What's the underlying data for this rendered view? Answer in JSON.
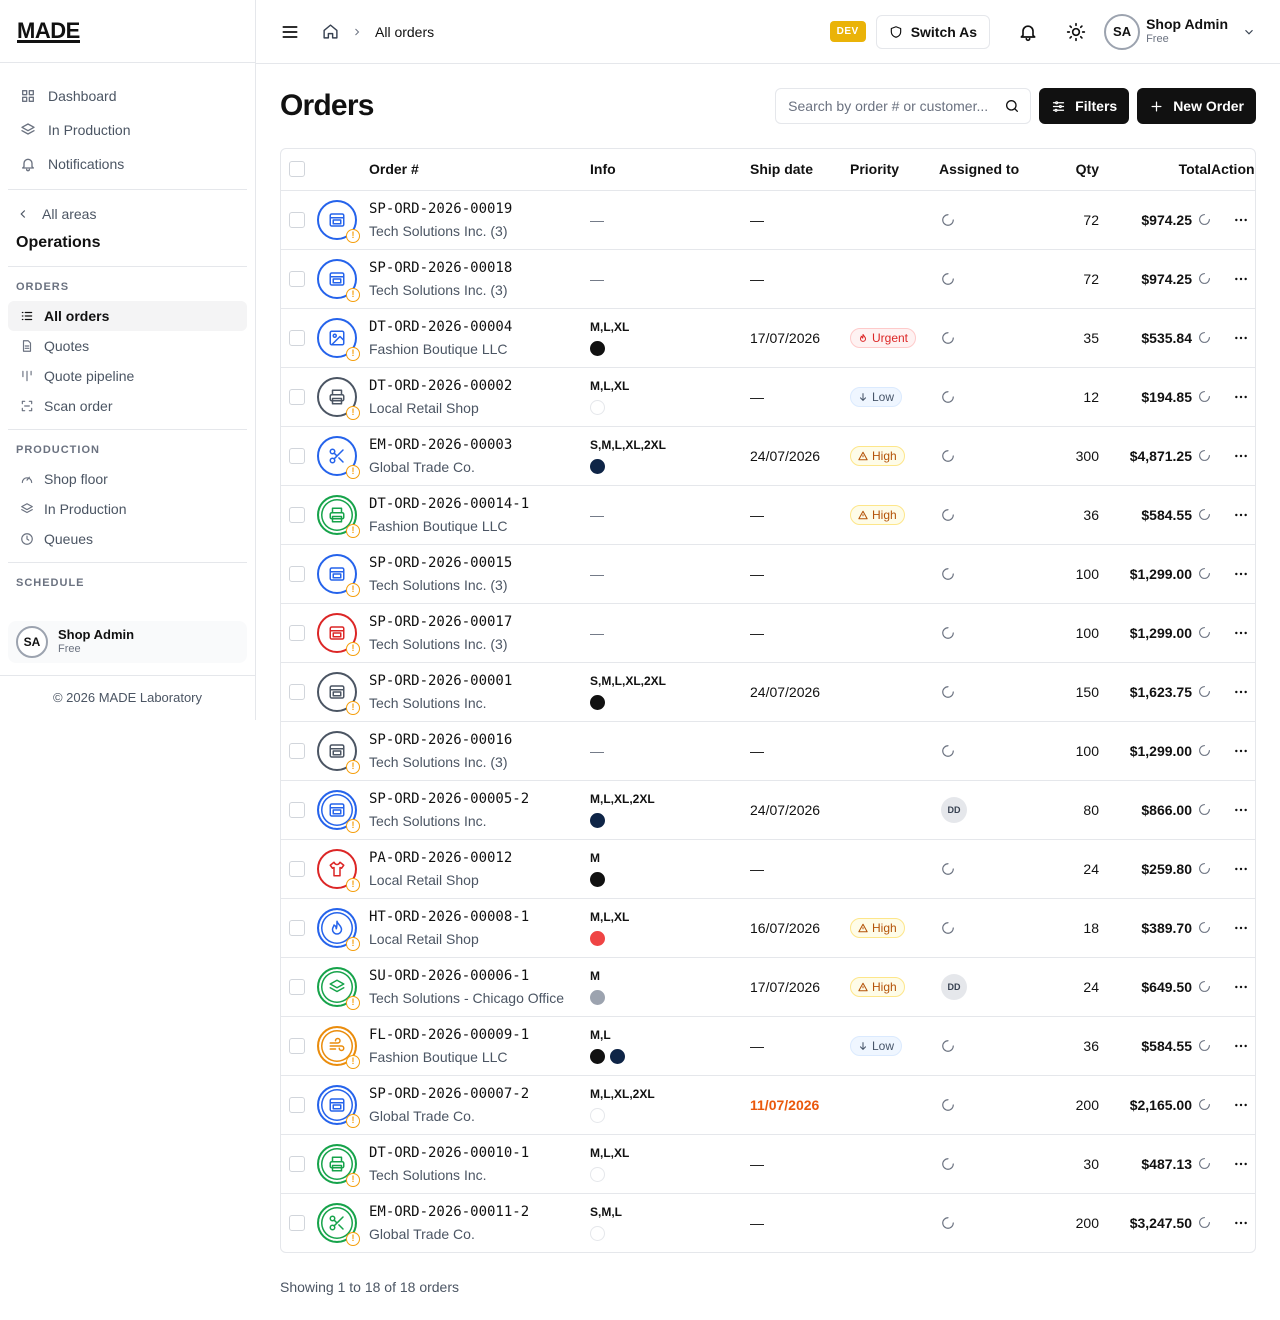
{
  "brand": "MADE",
  "sidebar": {
    "top_items": [
      {
        "label": "Dashboard",
        "icon": "grid-icon"
      },
      {
        "label": "In Production",
        "icon": "layers-icon"
      },
      {
        "label": "Notifications",
        "icon": "bell-icon"
      }
    ],
    "back_label": "All areas",
    "area_title": "Operations",
    "groups": [
      {
        "label": "ORDERS",
        "items": [
          {
            "label": "All orders",
            "icon": "list-icon",
            "active": true
          },
          {
            "label": "Quotes",
            "icon": "file-icon"
          },
          {
            "label": "Quote pipeline",
            "icon": "pipeline-icon"
          },
          {
            "label": "Scan order",
            "icon": "scan-icon"
          }
        ]
      },
      {
        "label": "PRODUCTION",
        "items": [
          {
            "label": "Shop floor",
            "icon": "gauge-icon"
          },
          {
            "label": "In Production",
            "icon": "layers-icon"
          },
          {
            "label": "Queues",
            "icon": "clock-icon"
          }
        ]
      },
      {
        "label": "SCHEDULE",
        "items": []
      }
    ],
    "user": {
      "initials": "SA",
      "name": "Shop Admin",
      "plan": "Free"
    },
    "copyright": "© 2026 MADE Laboratory"
  },
  "header": {
    "breadcrumb": "All orders",
    "env_badge": "DEV",
    "switch_label": "Switch As",
    "user": {
      "initials": "SA",
      "name": "Shop Admin",
      "plan": "Free"
    }
  },
  "main": {
    "title": "Orders",
    "search_placeholder": "Search by order # or customer...",
    "filters_label": "Filters",
    "new_order_label": "New Order",
    "columns": [
      "Order #",
      "Info",
      "Ship date",
      "Priority",
      "Assigned to",
      "Qty",
      "Total",
      "Actions"
    ],
    "footer": "Showing 1 to 18 of 18 orders"
  },
  "colors": {
    "blue": "#2563eb",
    "gray": "#4b5563",
    "green": "#16a34a",
    "red": "#dc2626",
    "orange": "#ea8c0c",
    "navy": "#0f2547",
    "black": "#111111",
    "lightgray": "#9ca3af",
    "redswatch": "#ef4444",
    "white": "#ffffff"
  },
  "orders": [
    {
      "number": "SP-ORD-2026-00019",
      "customer": "Tech Solutions Inc. (3)",
      "icon": "screen-print-icon",
      "color": "blue",
      "double": false,
      "sizes": "",
      "swatches": [],
      "info_dash": "—",
      "ship": "—",
      "overdue": false,
      "priority": "",
      "priority_type": "",
      "assignee": "",
      "qty": "72",
      "total": "$974.25"
    },
    {
      "number": "SP-ORD-2026-00018",
      "customer": "Tech Solutions Inc. (3)",
      "icon": "screen-print-icon",
      "color": "blue",
      "double": false,
      "sizes": "",
      "swatches": [],
      "info_dash": "—",
      "ship": "—",
      "overdue": false,
      "priority": "",
      "priority_type": "",
      "assignee": "",
      "qty": "72",
      "total": "$974.25"
    },
    {
      "number": "DT-ORD-2026-00004",
      "customer": "Fashion Boutique LLC",
      "icon": "image-icon",
      "color": "blue",
      "double": false,
      "sizes": "M,L,XL",
      "swatches": [
        "black"
      ],
      "info_dash": "",
      "ship": "17/07/2026",
      "overdue": false,
      "priority": "Urgent",
      "priority_type": "urgent",
      "assignee": "",
      "qty": "35",
      "total": "$535.84"
    },
    {
      "number": "DT-ORD-2026-00002",
      "customer": "Local Retail Shop",
      "icon": "printer-icon",
      "color": "gray",
      "double": false,
      "sizes": "M,L,XL",
      "swatches": [
        "white"
      ],
      "info_dash": "",
      "ship": "—",
      "overdue": false,
      "priority": "Low",
      "priority_type": "low",
      "assignee": "",
      "qty": "12",
      "total": "$194.85"
    },
    {
      "number": "EM-ORD-2026-00003",
      "customer": "Global Trade Co.",
      "icon": "scissors-icon",
      "color": "blue",
      "double": false,
      "sizes": "S,M,L,XL,2XL",
      "swatches": [
        "navy"
      ],
      "info_dash": "",
      "ship": "24/07/2026",
      "overdue": false,
      "priority": "High",
      "priority_type": "high",
      "assignee": "",
      "qty": "300",
      "total": "$4,871.25"
    },
    {
      "number": "DT-ORD-2026-00014-1",
      "customer": "Fashion Boutique LLC",
      "icon": "printer-icon",
      "color": "green",
      "double": true,
      "sizes": "",
      "swatches": [],
      "info_dash": "—",
      "ship": "—",
      "overdue": false,
      "priority": "High",
      "priority_type": "high",
      "assignee": "",
      "qty": "36",
      "total": "$584.55"
    },
    {
      "number": "SP-ORD-2026-00015",
      "customer": "Tech Solutions Inc. (3)",
      "icon": "screen-print-icon",
      "color": "blue",
      "double": false,
      "sizes": "",
      "swatches": [],
      "info_dash": "—",
      "ship": "—",
      "overdue": false,
      "priority": "",
      "priority_type": "",
      "assignee": "",
      "qty": "100",
      "total": "$1,299.00"
    },
    {
      "number": "SP-ORD-2026-00017",
      "customer": "Tech Solutions Inc. (3)",
      "icon": "screen-print-icon",
      "color": "red",
      "double": false,
      "sizes": "",
      "swatches": [],
      "info_dash": "—",
      "ship": "—",
      "overdue": false,
      "priority": "",
      "priority_type": "",
      "assignee": "",
      "qty": "100",
      "total": "$1,299.00"
    },
    {
      "number": "SP-ORD-2026-00001",
      "customer": "Tech Solutions Inc.",
      "icon": "screen-print-icon",
      "color": "gray",
      "double": false,
      "sizes": "S,M,L,XL,2XL",
      "swatches": [
        "black"
      ],
      "info_dash": "",
      "ship": "24/07/2026",
      "overdue": false,
      "priority": "",
      "priority_type": "",
      "assignee": "",
      "qty": "150",
      "total": "$1,623.75"
    },
    {
      "number": "SP-ORD-2026-00016",
      "customer": "Tech Solutions Inc. (3)",
      "icon": "screen-print-icon",
      "color": "gray",
      "double": false,
      "sizes": "",
      "swatches": [],
      "info_dash": "—",
      "ship": "—",
      "overdue": false,
      "priority": "",
      "priority_type": "",
      "assignee": "",
      "qty": "100",
      "total": "$1,299.00"
    },
    {
      "number": "SP-ORD-2026-00005-2",
      "customer": "Tech Solutions Inc.",
      "icon": "screen-print-icon",
      "color": "blue",
      "double": true,
      "sizes": "M,L,XL,2XL",
      "swatches": [
        "navy"
      ],
      "info_dash": "",
      "ship": "24/07/2026",
      "overdue": false,
      "priority": "",
      "priority_type": "",
      "assignee": "DD",
      "qty": "80",
      "total": "$866.00"
    },
    {
      "number": "PA-ORD-2026-00012",
      "customer": "Local Retail Shop",
      "icon": "shirt-icon",
      "color": "red",
      "double": false,
      "sizes": "M",
      "swatches": [
        "black"
      ],
      "info_dash": "",
      "ship": "—",
      "overdue": false,
      "priority": "",
      "priority_type": "",
      "assignee": "",
      "qty": "24",
      "total": "$259.80"
    },
    {
      "number": "HT-ORD-2026-00008-1",
      "customer": "Local Retail Shop",
      "icon": "flame-icon",
      "color": "blue",
      "double": true,
      "sizes": "M,L,XL",
      "swatches": [
        "redswatch"
      ],
      "info_dash": "",
      "ship": "16/07/2026",
      "overdue": false,
      "priority": "High",
      "priority_type": "high",
      "assignee": "",
      "qty": "18",
      "total": "$389.70"
    },
    {
      "number": "SU-ORD-2026-00006-1",
      "customer": "Tech Solutions - Chicago Office",
      "icon": "layers-icon",
      "color": "green",
      "double": true,
      "sizes": "M",
      "swatches": [
        "lightgray"
      ],
      "info_dash": "",
      "ship": "17/07/2026",
      "overdue": false,
      "priority": "High",
      "priority_type": "high",
      "assignee": "DD",
      "qty": "24",
      "total": "$649.50"
    },
    {
      "number": "FL-ORD-2026-00009-1",
      "customer": "Fashion Boutique LLC",
      "icon": "wind-icon",
      "color": "orange",
      "double": true,
      "sizes": "M,L",
      "swatches": [
        "black",
        "navy"
      ],
      "info_dash": "",
      "ship": "—",
      "overdue": false,
      "priority": "Low",
      "priority_type": "low",
      "assignee": "",
      "qty": "36",
      "total": "$584.55"
    },
    {
      "number": "SP-ORD-2026-00007-2",
      "customer": "Global Trade Co.",
      "icon": "screen-print-icon",
      "color": "blue",
      "double": true,
      "sizes": "M,L,XL,2XL",
      "swatches": [
        "white"
      ],
      "info_dash": "",
      "ship": "11/07/2026",
      "overdue": true,
      "priority": "",
      "priority_type": "",
      "assignee": "",
      "qty": "200",
      "total": "$2,165.00"
    },
    {
      "number": "DT-ORD-2026-00010-1",
      "customer": "Tech Solutions Inc.",
      "icon": "printer-icon",
      "color": "green",
      "double": true,
      "sizes": "M,L,XL",
      "swatches": [
        "white"
      ],
      "info_dash": "",
      "ship": "—",
      "overdue": false,
      "priority": "",
      "priority_type": "",
      "assignee": "",
      "qty": "30",
      "total": "$487.13"
    },
    {
      "number": "EM-ORD-2026-00011-2",
      "customer": "Global Trade Co.",
      "icon": "scissors-icon",
      "color": "green",
      "double": true,
      "sizes": "S,M,L",
      "swatches": [
        "white"
      ],
      "info_dash": "",
      "ship": "—",
      "overdue": false,
      "priority": "",
      "priority_type": "",
      "assignee": "",
      "qty": "200",
      "total": "$3,247.50"
    }
  ]
}
